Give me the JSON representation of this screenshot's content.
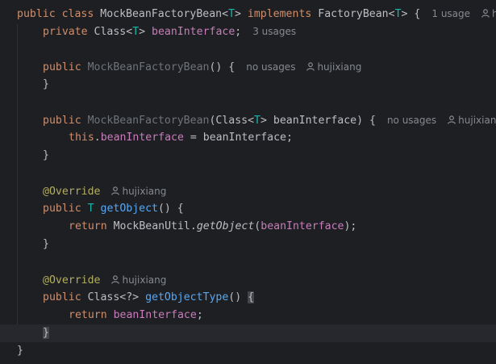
{
  "editor": {
    "language": "java",
    "class_name": "MockBeanFactoryBean",
    "lines": [
      {
        "id": "class-decl",
        "kw_public": "public",
        "kw_class": "class",
        "name": "MockBeanFactoryBean",
        "lt": "<",
        "tparam": "T",
        "gt": ">",
        "kw_implements": "implements",
        "iface": "FactoryBean",
        "iface_lt": "<",
        "iface_tparam": "T",
        "iface_gt": ">",
        "brace": " {",
        "usage_hint": "1 usage",
        "author_hint": "h"
      },
      {
        "id": "field-decl",
        "kw_private": "private",
        "type": "Class",
        "lt": "<",
        "tparam": "T",
        "gt": ">",
        "name": "beanInterface",
        "semi": ";",
        "usage_hint": "3 usages"
      },
      {
        "id": "ctor1",
        "kw_public": "public",
        "name": "MockBeanFactoryBean",
        "rest": "() {",
        "usage_hint": "no usages",
        "author": "hujixiang"
      },
      {
        "id": "ctor1-close",
        "text": "}"
      },
      {
        "id": "ctor2",
        "kw_public": "public",
        "name": "MockBeanFactoryBean",
        "params_pre": "(Class",
        "lt": "<",
        "tparam": "T",
        "gt": ">",
        "params_post": " beanInterface) {",
        "usage_hint": "no usages",
        "author": "hujixiang"
      },
      {
        "id": "ctor2-body",
        "kw_this": "this",
        "dot": ".",
        "field": "beanInterface",
        "rest": " = beanInterface;"
      },
      {
        "id": "ctor2-close",
        "text": "}"
      },
      {
        "id": "ann1",
        "annotation": "@Override",
        "author": "hujixiang"
      },
      {
        "id": "getobject-decl",
        "kw_public": "public",
        "tparam": "T",
        "method": "getObject",
        "rest": "() {"
      },
      {
        "id": "getobject-body",
        "kw_return": "return",
        "util": "MockBeanUtil",
        "dot": ".",
        "call": "getObject",
        "open": "(",
        "field": "beanInterface",
        "close": ");"
      },
      {
        "id": "getobject-close",
        "text": "}"
      },
      {
        "id": "ann2",
        "annotation": "@Override",
        "author": "hujixiang"
      },
      {
        "id": "getobjecttype-decl",
        "kw_public": "public",
        "type": "Class<?>",
        "method": "getObjectType",
        "rest": "() ",
        "brace": "{"
      },
      {
        "id": "getobjecttype-body",
        "kw_return": "return",
        "field": "beanInterface",
        "semi": ";"
      },
      {
        "id": "getobjecttype-close",
        "text": "}"
      },
      {
        "id": "class-close",
        "text": "}"
      }
    ]
  },
  "colors": {
    "background": "#1e1f22",
    "keyword": "#cf8e6d",
    "type_param": "#16baac",
    "field": "#c77dbb",
    "method": "#56a8f5",
    "annotation": "#b3ae60",
    "unused": "#6f737a",
    "hint": "#868991",
    "default": "#bcbec4"
  },
  "icons": {
    "author": "person-icon"
  }
}
